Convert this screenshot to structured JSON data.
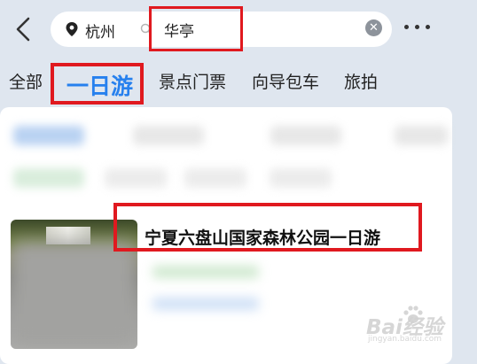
{
  "header": {
    "city": "杭州",
    "keyword": "华亭"
  },
  "tabs": [
    {
      "label": "全部"
    },
    {
      "label": "一日游",
      "active": true
    },
    {
      "label": "景点门票"
    },
    {
      "label": "向导包车"
    },
    {
      "label": "旅拍"
    }
  ],
  "result": {
    "title": "宁夏六盘山国家森林公园一日游"
  },
  "watermark": {
    "main": "Bai经验",
    "sub": "jingyan.baidu.com"
  },
  "colors": {
    "accent": "#2680ee",
    "highlight": "#e0191f",
    "background": "#dfe6ef"
  }
}
